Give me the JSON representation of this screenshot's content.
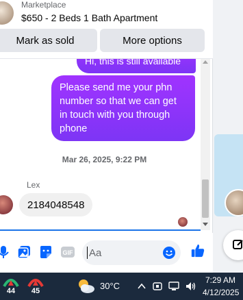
{
  "listing": {
    "source": "Marketplace",
    "title": "$650 - 2 Beds 1 Bath Apartment"
  },
  "actions": {
    "mark_sold": "Mark as sold",
    "more_options": "More options"
  },
  "messages": {
    "outgoing_partial": "Hi, this is still available",
    "outgoing_main": "Please send me your phn number so that we can get in touch with you through phone",
    "timestamp": "Mar 26, 2025, 9:22 PM",
    "sender_name": "Lex",
    "incoming": "2184048548"
  },
  "composer": {
    "placeholder": "Aa",
    "icons": [
      "microphone-icon",
      "photo-icon",
      "sticker-icon",
      "gif-icon",
      "emoji-icon",
      "like-icon"
    ]
  },
  "taskbar": {
    "app1_badge": "44",
    "app2_badge": "45",
    "weather_icon": "partly-cloudy-icon",
    "temperature": "30°C",
    "time": "7:29 AM",
    "date": "4/12/2025"
  },
  "colors": {
    "accent": "#0866ff",
    "outgoing_bubble_top": "#a033ff",
    "outgoing_bubble_bottom": "#7d35f5",
    "incoming_bubble": "#f0f0f0",
    "taskbar": "#1b2a3d"
  }
}
